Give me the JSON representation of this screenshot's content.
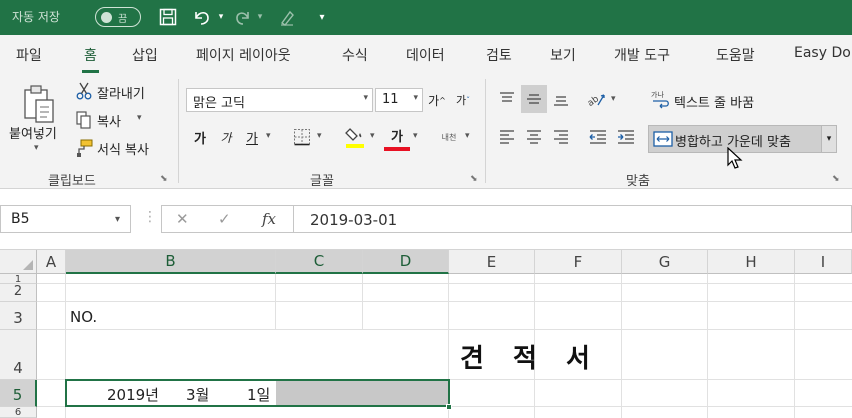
{
  "titlebar": {
    "autosave_label": "자동 저장",
    "autosave_state": "끔",
    "icons": [
      "save-icon",
      "undo-icon",
      "redo-icon",
      "format-painter-icon",
      "customize-qat-icon"
    ]
  },
  "tabs": [
    "파일",
    "홈",
    "삽입",
    "페이지 레이아웃",
    "수식",
    "데이터",
    "검토",
    "보기",
    "개발 도구",
    "도움말",
    "Easy Do"
  ],
  "active_tab": "홈",
  "ribbon": {
    "clipboard": {
      "paste": "붙여넣기",
      "cut": "잘라내기",
      "copy": "복사",
      "format_painter": "서식 복사",
      "label": "클립보드"
    },
    "font": {
      "font_name": "맑은 고딕",
      "font_size": "11",
      "bold": "가",
      "italic": "가",
      "underline": "가",
      "font_color_glyph": "가",
      "phonetic_glyph": "내천",
      "label": "글꼴"
    },
    "alignment": {
      "wrap_text": "텍스트 줄 바꿈",
      "merge_center": "병합하고 가운데 맞춤",
      "label": "맞춤"
    }
  },
  "formula_bar": {
    "name_box": "B5",
    "fx": "fx",
    "formula": "2019-03-01"
  },
  "grid": {
    "columns": [
      "A",
      "B",
      "C",
      "D",
      "E",
      "F",
      "G",
      "H",
      "I"
    ],
    "selected_columns": [
      "B",
      "C",
      "D"
    ],
    "rows": [
      "1",
      "2",
      "3",
      "4",
      "5",
      "6"
    ],
    "selected_row": "5",
    "cells": {
      "B3": "NO.",
      "title": "견 적 서",
      "date_year": "2019년",
      "date_month": "3월",
      "date_day": "1일"
    }
  },
  "colors": {
    "accent": "#217346",
    "selection_fill": "#c8c8c8"
  }
}
